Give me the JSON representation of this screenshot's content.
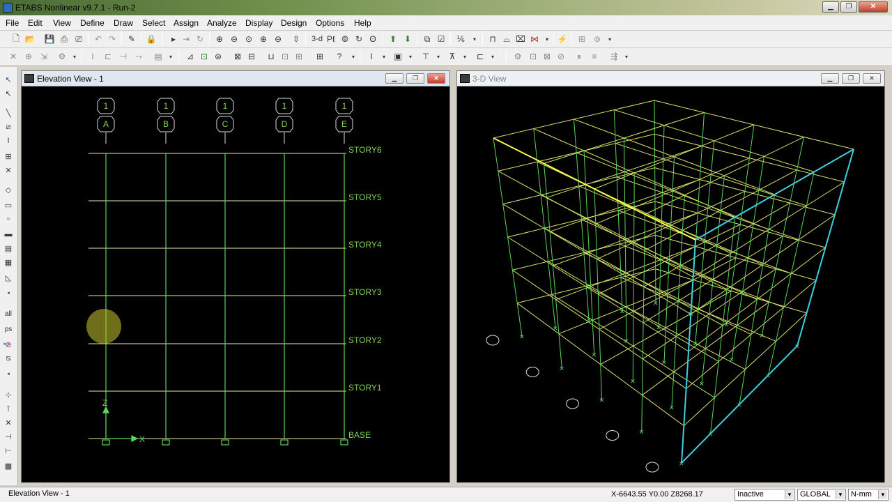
{
  "window": {
    "title": "ETABS Nonlinear v9.7.1 - Run-2"
  },
  "menu": [
    "File",
    "Edit",
    "View",
    "Define",
    "Draw",
    "Select",
    "Assign",
    "Analyze",
    "Display",
    "Design",
    "Options",
    "Help"
  ],
  "toolbar": {
    "view_3d_label": "3-d"
  },
  "left_toolbar": {
    "all_label": "all",
    "ps_label": "ps"
  },
  "elevation_view": {
    "title": "Elevation View - 1",
    "grid_bubbles": [
      {
        "top": "1",
        "bottom": "A"
      },
      {
        "top": "1",
        "bottom": "B"
      },
      {
        "top": "1",
        "bottom": "C"
      },
      {
        "top": "1",
        "bottom": "D"
      },
      {
        "top": "1",
        "bottom": "E"
      }
    ],
    "stories": [
      "STORY6",
      "STORY5",
      "STORY4",
      "STORY3",
      "STORY2",
      "STORY1",
      "BASE"
    ],
    "axis_z": "Z",
    "axis_x": "X"
  },
  "view_3d": {
    "title": "3-D View"
  },
  "status": {
    "left": "Elevation View - 1",
    "coords": "X-6643.55  Y0.00  Z8268.17",
    "state_select": "Inactive",
    "coord_system": "GLOBAL",
    "units": "N-mm"
  },
  "colors": {
    "grid": "#d8e26a",
    "column": "#5ad65a",
    "label": "#7ed34f",
    "highlight": "#3fd0e0"
  }
}
